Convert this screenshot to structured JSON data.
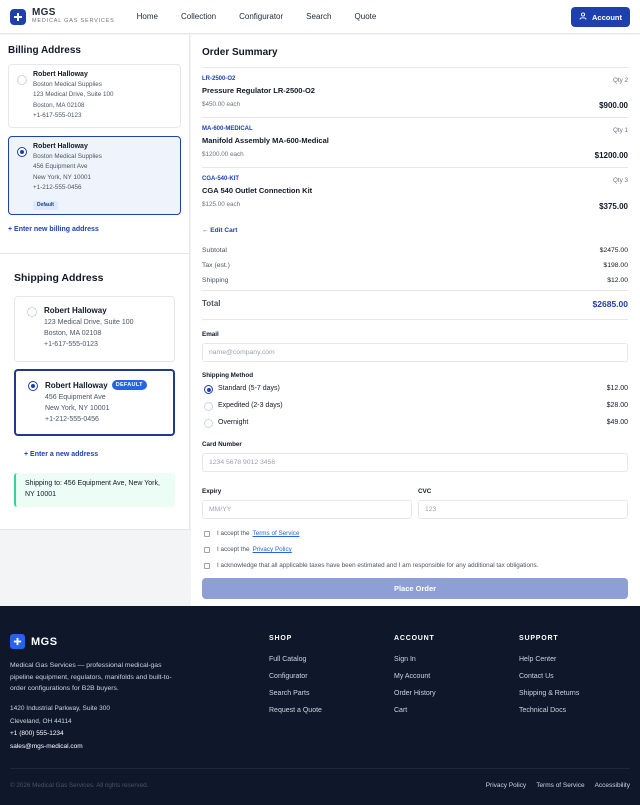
{
  "brand": {
    "name": "MGS",
    "tagline": "MEDICAL GAS SERVICES"
  },
  "nav": [
    "Home",
    "Collection",
    "Configurator",
    "Search",
    "Quote"
  ],
  "account_label": "Account",
  "billing": {
    "title": "Billing Address",
    "addresses": [
      {
        "name": "Robert Halloway",
        "company": "Boston Medical Supplies",
        "street": "123 Medical Drive, Suite 100",
        "city": "Boston, MA 02108",
        "phone": "+1-617-555-0123"
      },
      {
        "name": "Robert Halloway",
        "company": "Boston Medical Supplies",
        "street": "456 Equipment Ave",
        "city": "New York, NY 10001",
        "phone": "+1-212-555-0456",
        "badge": "Default"
      }
    ],
    "add_link": "+ Enter new billing address"
  },
  "shipping": {
    "title": "Shipping Address",
    "addresses": [
      {
        "name": "Robert Halloway",
        "street": "123 Medical Drive, Suite 100",
        "city": "Boston, MA 02108",
        "phone": "+1-617-555-0123"
      },
      {
        "name": "Robert Halloway",
        "badge": "DEFAULT",
        "street": "456 Equipment Ave",
        "city": "New York, NY 10001",
        "phone": "+1-212-555-0456"
      }
    ],
    "add_link": "+ Enter a new address",
    "ship_to": "Shipping to: 456 Equipment Ave, New York, NY 10001"
  },
  "order": {
    "title": "Order Summary",
    "items": [
      {
        "sku": "LR-2500-O2",
        "qty": "Qty 2",
        "name": "Pressure Regulator LR-2500-O2",
        "each": "$450.00 each",
        "total": "$900.00"
      },
      {
        "sku": "MA-600-MEDICAL",
        "qty": "Qty 1",
        "name": "Manifold Assembly MA-600-Medical",
        "each": "$1200.00 each",
        "total": "$1200.00"
      },
      {
        "sku": "CGA-540-KIT",
        "qty": "Qty 3",
        "name": "CGA 540 Outlet Connection Kit",
        "each": "$125.00 each",
        "total": "$375.00"
      }
    ],
    "edit_cart": "← Edit Cart",
    "subtotal_label": "Subtotal",
    "subtotal": "$2475.00",
    "tax_label": "Tax (est.)",
    "tax": "$198.00",
    "shipping_label": "Shipping",
    "shipping": "$12.00",
    "total_label": "Total",
    "total": "$2685.00"
  },
  "form": {
    "email_label": "Email",
    "email_placeholder": "name@company.com",
    "shipping_method_label": "Shipping Method",
    "shipping_options": [
      {
        "label": "Standard (5-7 days)",
        "price": "$12.00"
      },
      {
        "label": "Expedited (2-3 days)",
        "price": "$28.00"
      },
      {
        "label": "Overnight",
        "price": "$49.00"
      }
    ],
    "card_label": "Card Number",
    "card_placeholder": "1234 5678 9012 3456",
    "expiry_label": "Expiry",
    "expiry_placeholder": "MM/YY",
    "cvc_label": "CVC",
    "cvc_placeholder": "123",
    "accept_prefix": "I accept the",
    "terms_link": "Terms of Service",
    "privacy_link": "Privacy Policy",
    "tax_ack": "I acknowledge that all applicable taxes have been estimated and I am responsible for any additional tax obligations.",
    "place_order": "Place Order"
  },
  "footer": {
    "brand": "MGS",
    "description": "Medical Gas Services — professional medical-gas pipeline equipment, regulators, manifolds and built-to-order configurations for B2B buyers.",
    "address1": "1420 Industrial Parkway, Suite 300",
    "address2": "Cleveland, OH 44114",
    "phone": "+1 (800) 555-1234",
    "email": "sales@mgs-medical.com",
    "columns": [
      {
        "title": "SHOP",
        "links": [
          "Full Catalog",
          "Configurator",
          "Search Parts",
          "Request a Quote"
        ]
      },
      {
        "title": "ACCOUNT",
        "links": [
          "Sign In",
          "My Account",
          "Order History",
          "Cart"
        ]
      },
      {
        "title": "SUPPORT",
        "links": [
          "Help Center",
          "Contact Us",
          "Shipping & Returns",
          "Technical Docs"
        ]
      }
    ],
    "copyright": "© 2026 Medical Gas Services. All rights reserved.",
    "legal": [
      "Privacy Policy",
      "Terms of Service",
      "Accessibility"
    ]
  },
  "colors": {
    "brand": "#1e40af",
    "footer_bg": "#0f172a",
    "place_order_bg": "#8e9fd5",
    "ship_to_bg": "#ecfdf5"
  }
}
